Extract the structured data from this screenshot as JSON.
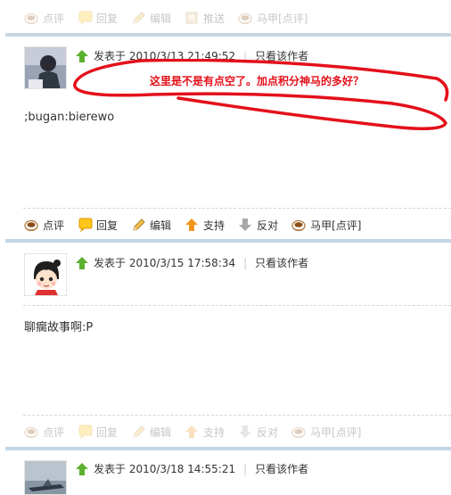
{
  "actions_top": [
    "点评",
    "回复",
    "编辑",
    "推送",
    "马甲[点评]"
  ],
  "actions": [
    "点评",
    "回复",
    "编辑",
    "支持",
    "反对",
    "马甲[点评]"
  ],
  "posts": [
    {
      "posted_prefix": "发表于",
      "date": "2010/3/13 21:49:52",
      "author_only": "只看该作者",
      "content": ";bugan:bierewo",
      "annotation": "这里是不是有点空了。加点积分神马的多好？"
    },
    {
      "posted_prefix": "发表于",
      "date": "2010/3/15 17:58:34",
      "author_only": "只看该作者",
      "content": "聊瘸故事啊:P"
    },
    {
      "posted_prefix": "发表于",
      "date": "2010/3/18 14:55:21",
      "author_only": "只看该作者"
    }
  ],
  "colors": {
    "annotation_red": "#e4101a",
    "separator": "#c5d5e4",
    "up_arrow": "#5cb030",
    "support_arrow": "#f0961e"
  }
}
